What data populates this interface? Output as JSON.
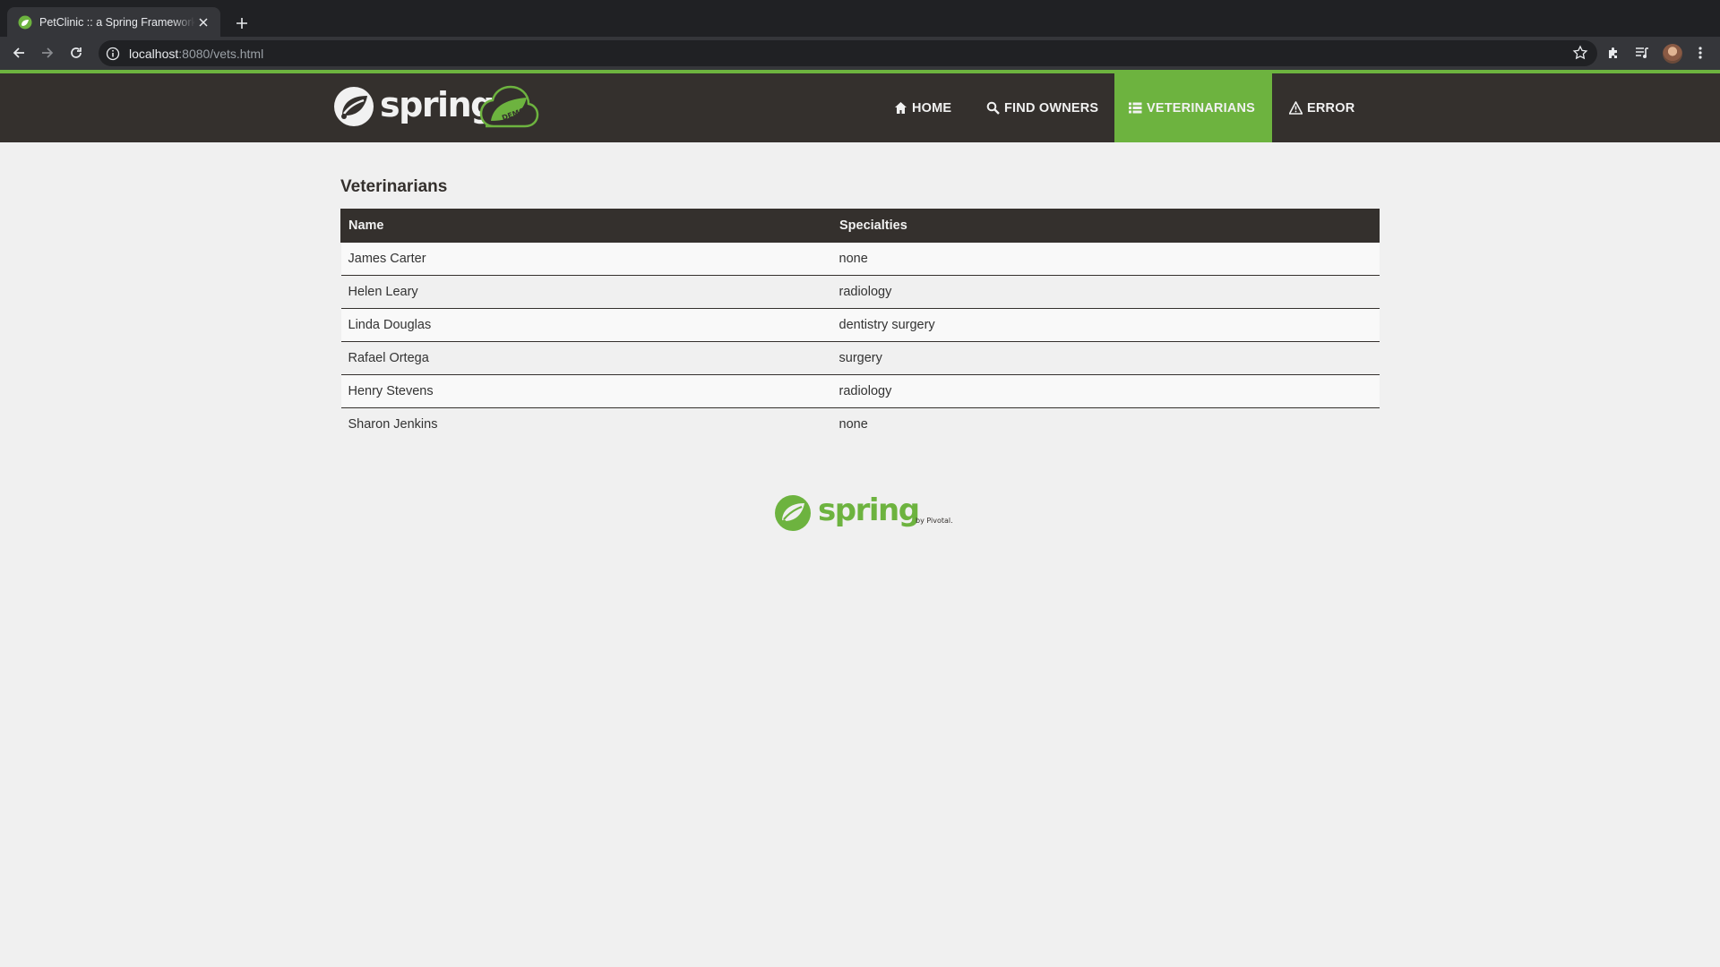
{
  "browser": {
    "tab_title": "PetClinic :: a Spring Framework demonstration",
    "url_host": "localhost",
    "url_rest": ":8080/vets.html"
  },
  "brand": {
    "logo_text": "spring",
    "badge_text": "DEMO"
  },
  "nav": {
    "home": "Home",
    "find_owners": "Find owners",
    "veterinarians": "Veterinarians",
    "error": "Error",
    "active": "veterinarians",
    "accent_color": "#6db33f",
    "bar_color": "#34302d"
  },
  "page": {
    "title": "Veterinarians"
  },
  "table": {
    "headers": [
      "Name",
      "Specialties"
    ],
    "rows": [
      {
        "name": "James Carter",
        "specialties": "none"
      },
      {
        "name": "Helen Leary",
        "specialties": "radiology"
      },
      {
        "name": "Linda Douglas",
        "specialties": "dentistry surgery"
      },
      {
        "name": "Rafael Ortega",
        "specialties": "surgery"
      },
      {
        "name": "Henry Stevens",
        "specialties": "radiology"
      },
      {
        "name": "Sharon Jenkins",
        "specialties": "none"
      }
    ]
  },
  "footer": {
    "logo_text": "spring",
    "byline": "by Pivotal."
  }
}
